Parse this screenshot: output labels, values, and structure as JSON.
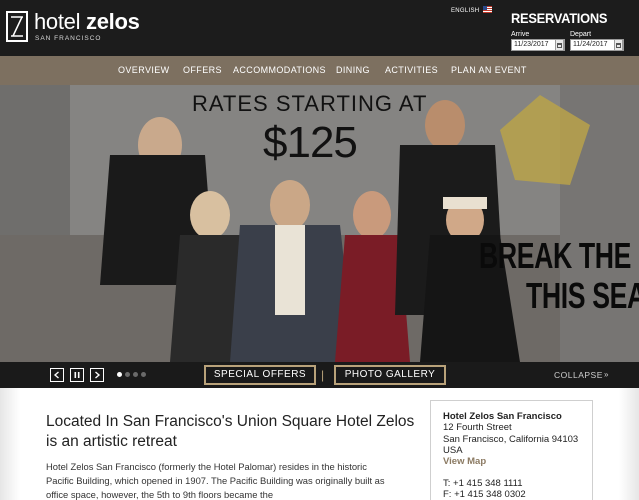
{
  "brand": {
    "name_light": "hotel",
    "name_bold": "zelos",
    "tagline": "SAN FRANCISCO"
  },
  "language": "ENGLISH",
  "reservations": {
    "title": "RESERVATIONS",
    "arrive_label": "Arrive",
    "arrive_value": "11/23/2017",
    "depart_label": "Depart",
    "depart_value": "11/24/2017"
  },
  "nav": {
    "items": [
      {
        "label": "OVERVIEW"
      },
      {
        "label": "OFFERS"
      },
      {
        "label": "ACCOMMODATIONS"
      },
      {
        "label": "DINING"
      },
      {
        "label": "ACTIVITIES"
      },
      {
        "label": "PLAN AN EVENT"
      }
    ]
  },
  "hero": {
    "title": "RATES STARTING AT",
    "price": "$125",
    "promo_line1": "BREAK THE RU",
    "promo_line2": "THIS SEAS"
  },
  "controls": {
    "prev_icon": "chevron-left-icon",
    "pause_icon": "pause-icon",
    "next_icon": "chevron-right-icon",
    "slide_count": 4,
    "active_slide": 1,
    "special_offers": "SPECIAL OFFERS",
    "separator": "|",
    "photo_gallery": "PHOTO GALLERY",
    "collapse": "COLLAPSE",
    "collapse_icon": "double-chevron-down-icon"
  },
  "main": {
    "headline": "Located In San Francisco's Union Square Hotel Zelos is an artistic retreat",
    "body": "Hotel Zelos San Francisco (formerly the Hotel Palomar) resides in the historic Pacific Building, which opened in 1907. The Pacific Building was originally built as office space, however, the 5th to 9th floors became the"
  },
  "contact": {
    "name": "Hotel Zelos San Francisco",
    "street": "12 Fourth Street",
    "city": "San Francisco, California 94103",
    "country": "USA",
    "map_link": "View Map",
    "phone": "T: +1 415 348 1111",
    "fax": "F: +1 415 348 0302"
  },
  "colors": {
    "header_bg": "#1c1c1c",
    "nav_bg": "#7d7060",
    "accent_gold": "#b9a27a",
    "link_color": "#8b7a62"
  }
}
